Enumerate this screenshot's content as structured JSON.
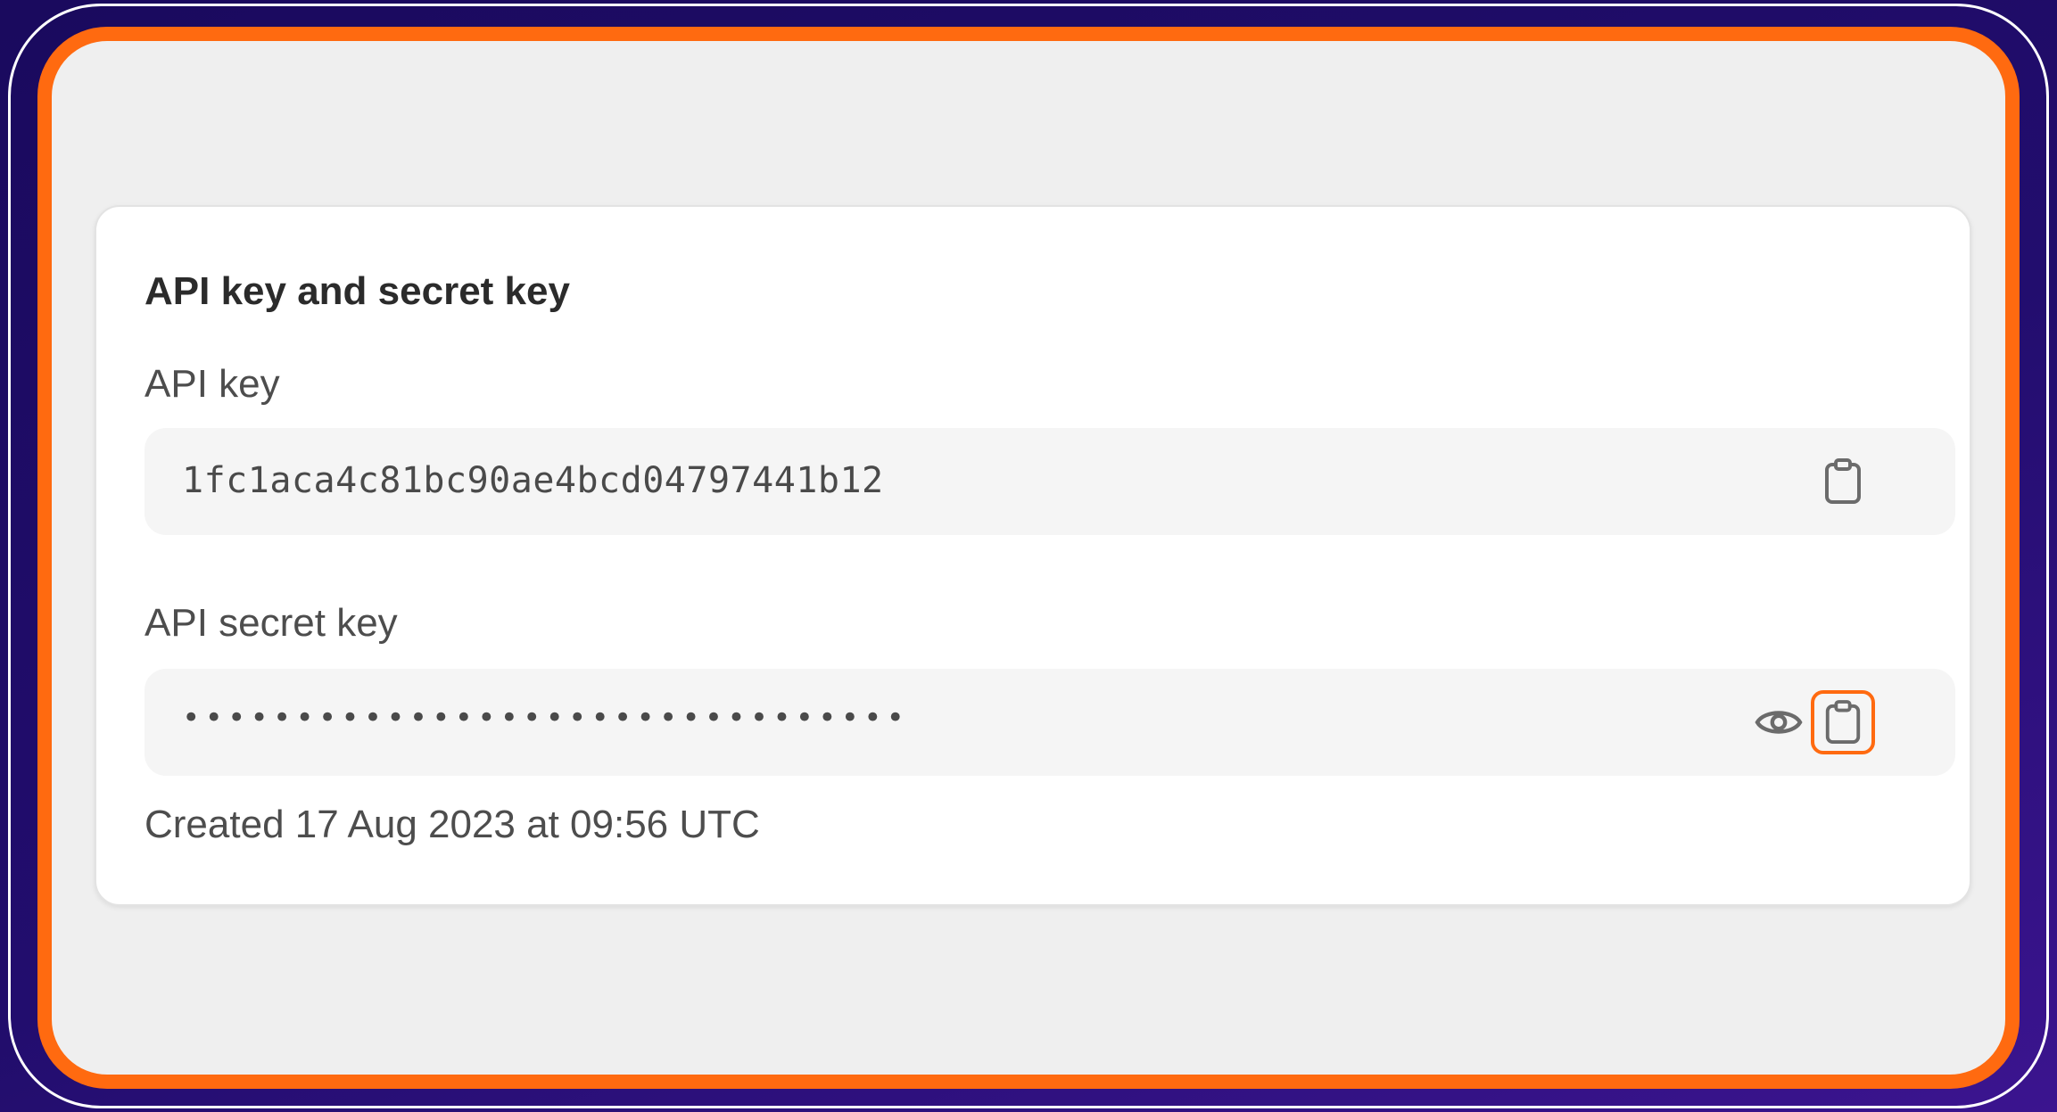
{
  "card": {
    "title": "API key and secret key"
  },
  "api_key": {
    "label": "API key",
    "value": "1fc1aca4c81bc90ae4bcd04797441b12",
    "copy_icon": "clipboard-icon"
  },
  "api_secret_key": {
    "label": "API secret key",
    "value": "••••••••••••••••••••••••••••••••",
    "reveal_icon": "eye-icon",
    "copy_icon": "clipboard-icon"
  },
  "created": {
    "text": "Created 17 Aug 2023 at 09:56 UTC"
  },
  "colors": {
    "highlight": "#ff6a10",
    "background_outer": "#1a0a5e",
    "panel": "#efefef",
    "card": "#ffffff",
    "field": "#f5f5f5"
  }
}
